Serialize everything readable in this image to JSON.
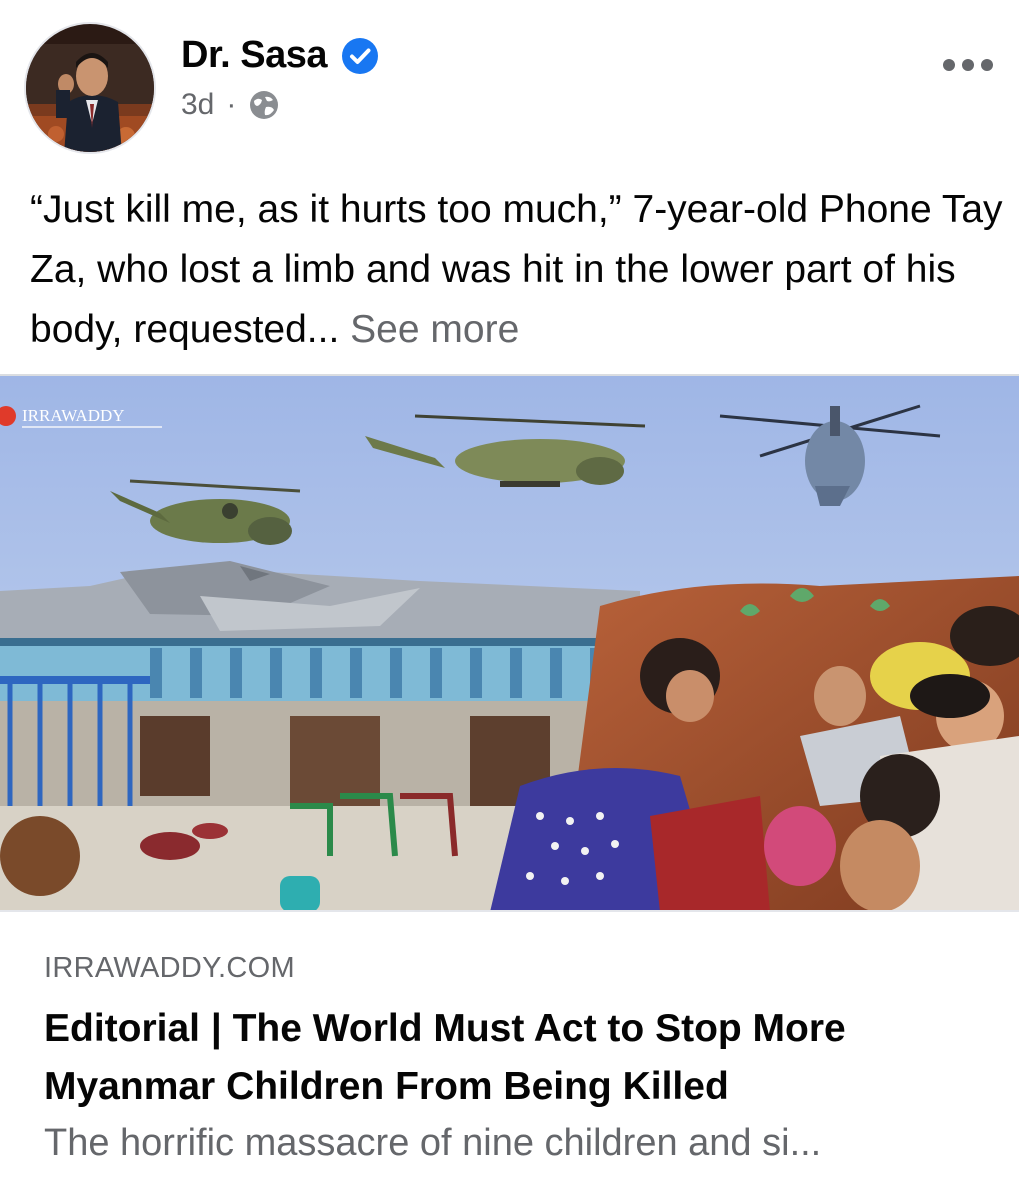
{
  "post": {
    "author": {
      "name": "Dr. Sasa",
      "verified": true
    },
    "timestamp": "3d",
    "separator": "·",
    "audience_icon": "globe-icon",
    "more_icon": "more-options-icon",
    "text": "“Just kill me, as it hurts too much,” 7-year-old Phone Tay Za, who lost a limb and was hit in the lower part of his body, requested...",
    "see_more_label": "See more"
  },
  "image": {
    "watermark": "IRRAWADDY"
  },
  "link_preview": {
    "domain": "IRRAWADDY.COM",
    "title": "Editorial | The World Must Act to Stop More Myanmar Children From Being Killed",
    "description": "The horrific massacre of nine children and si..."
  },
  "colors": {
    "verified_blue": "#1877f2",
    "secondary_text": "#65676b",
    "primary_text": "#050505"
  }
}
